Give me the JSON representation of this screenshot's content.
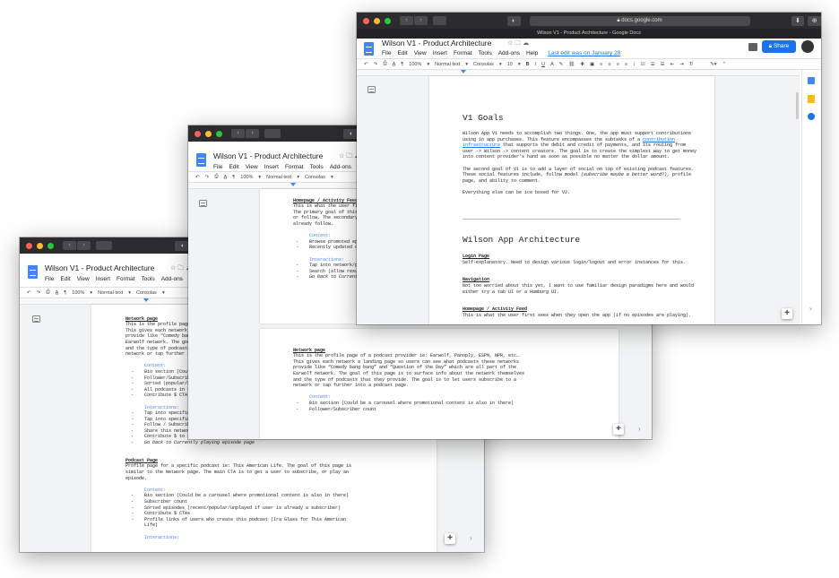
{
  "app": {
    "doc_title": "Wilson V1 - Product Architecture",
    "tab_title": "Wilson V1 - Product Architecture - Google Docs",
    "url": "docs.google.com",
    "menus": [
      "File",
      "Edit",
      "View",
      "Insert",
      "Format",
      "Tools",
      "Add-ons",
      "Help"
    ],
    "last_edit": "Last edit was on January 28",
    "share_label": "Share",
    "zoom": "100%",
    "style": "Normal text",
    "font": "Consolas",
    "font_size": "10",
    "title_icons": "☆ 🗀 ☁"
  },
  "win3": {
    "goals_title": "V1 Goals",
    "goals_p1": [
      "Wilson App V1 needs to accomplish two things. One, the app must support contributions",
      "using in app purchases. This feature encompasses the subtasks of a ",
      "contribution",
      "infrastructure",
      " that supports the debit and credit of payments, and its routing from",
      "user -> Wilson -> content creators. The goal is to create the simplest way to get money",
      "into content provider's hand as soon as possible no matter the dollar amount."
    ],
    "goals_p2a": "The second goal of V1 is to add a layer of social on top of existing podcast features.",
    "goals_p2b": "These social features include, follow model ",
    "goals_p2b_it": "(subscribe maybe a better word?)",
    "goals_p2b_end": ", profile",
    "goals_p2c": "page, and ability to comment.",
    "goals_p3": "Everything else can be ice boxed for V2.",
    "arch_title": "Wilson App Architecture",
    "login_h": "Login Page",
    "login_p": "Self-explanatory. Need to design various login/logout and error instances for this.",
    "nav_h": "Navigation",
    "nav_p1": "Not too worried about this yet, I want to use familiar design paradigms here and would",
    "nav_p2": "either try a tab UI or a Hamburg UI.",
    "home_h": "Homepage / Activity Feed",
    "home_p": "This is what the user first sees when they open the app (if no episodes are playing)."
  },
  "win2": {
    "home_h": "Homepage / Activity Feed",
    "home_lines": [
      "This is what the user fir",
      "The primary goal of this ",
      "or follow. The secondary ",
      "already follow."
    ],
    "content_label": "Content:",
    "content_items": [
      "Browse promoted ep",
      "Recently updated c"
    ],
    "interactions_label": "Interactions:",
    "interaction_items": [
      "Tap into network/p",
      "Search (allow resu",
      "Go back to Current"
    ],
    "network_h": "Network page",
    "network_lines": [
      "This is the profile page of a podcast provider ie: Earwolf, Panoply, ESPN, NPR, etc…",
      "This gives each network a landing page so users can see what podcasts these networks",
      "provide like “Comedy bang bang” and “Question of the Day” which are all part of the",
      "Earwolf network. The goal of this page is to surface info about the network themselves",
      "and the type of podcasts that they provide. The goal is to let users subscribe to a",
      "network or tap further into a podcast page."
    ],
    "net_content_label": "Content:",
    "net_content_items": [
      "Bio section (Could be a carousel where promotional content is also in there)",
      "Follower/Subscriber count"
    ]
  },
  "win1": {
    "network_h": "Network page",
    "network_lines": [
      "This is the profile page ",
      "This gives each network a",
      "provide like “Comedy bang",
      "Earwolf network. The goal",
      "and the type of podcasts ",
      "network or tap further in"
    ],
    "content_label": "Content:",
    "content_items": [
      "Bio section (Could",
      "Follower/Subscribe",
      "Sorted (popular/re",
      "All podcasts in th",
      "Contribute $ CTA"
    ],
    "interactions_label": "Interactions:",
    "interaction_items": [
      "Tap into specific ",
      "Tap into specific ",
      "Follow / Subscribe",
      "Share this network",
      "Contribute $ to this network",
      "Go back to Currently playing episode page"
    ],
    "podcast_h": "Podcast Page",
    "podcast_lines": [
      "Profile page for a specific podcast ie: This American Life. The goal of this page is",
      "similar to the Network page. The main CTA is to get a user to subscribe, or play an",
      "episode."
    ],
    "pc_content_label": "Content:",
    "pc_content_items": [
      "Bio section (Could be a carousel where promotional content is also in there)",
      "Subscriber count",
      "Sorted episodes (recent/popular/unplayed if user is already a subscriber)",
      "Contribute $ CTAs",
      "Profile links of users who create this podcast (Ira Glass for This American"
    ],
    "pc_content_cont": "Life)",
    "pc_interactions_label": "Interactions:"
  }
}
